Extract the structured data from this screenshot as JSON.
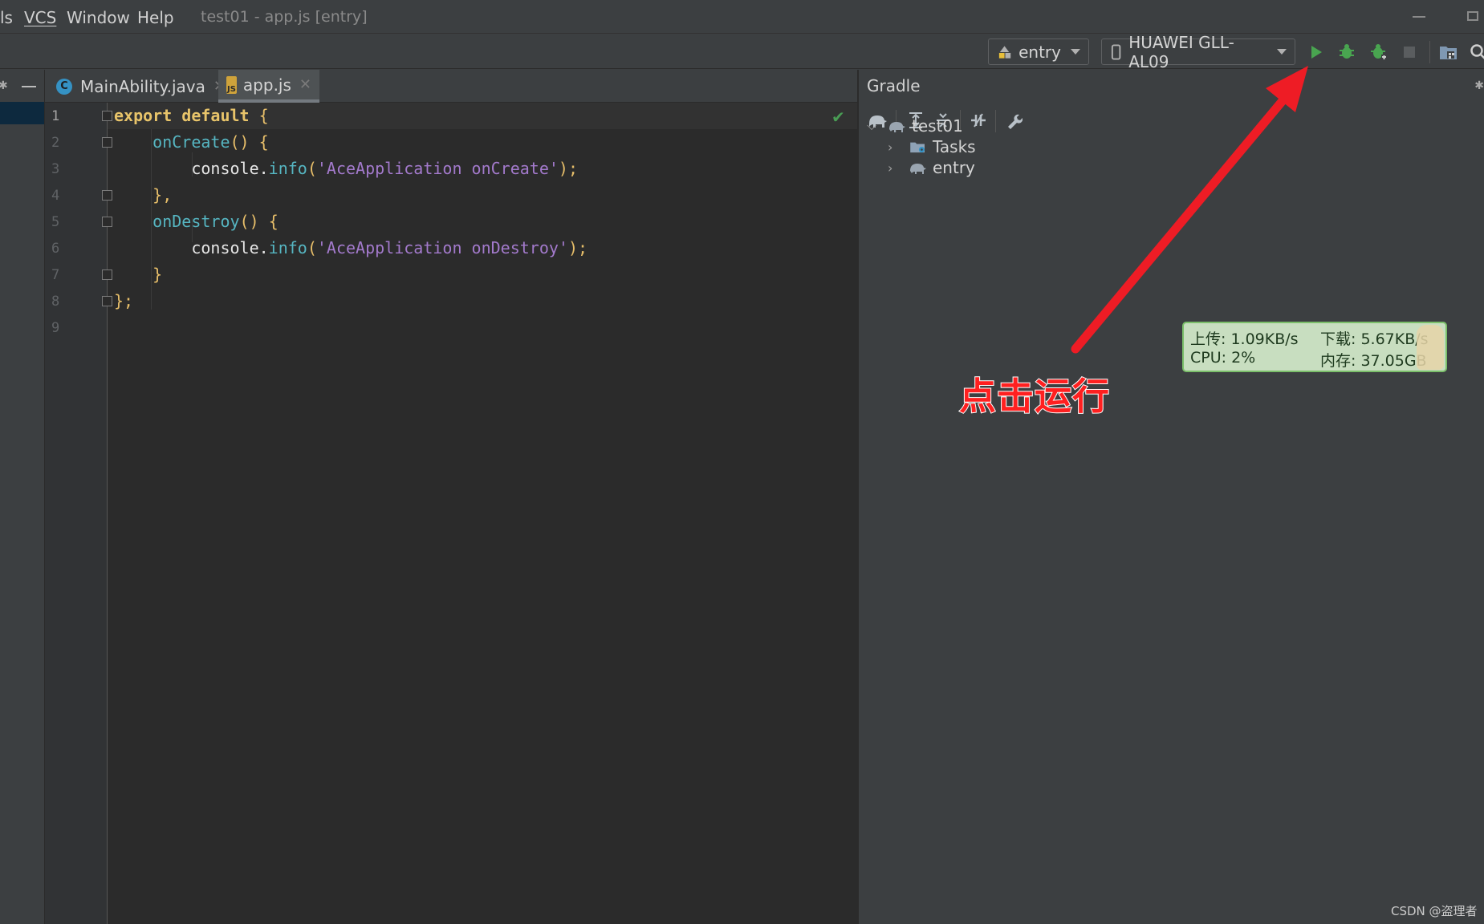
{
  "menubar": {
    "items": [
      "ls",
      "VCS",
      "Window",
      "Help"
    ],
    "title": "test01 - app.js [entry]"
  },
  "toolbar": {
    "module_combo": "entry",
    "device_combo": "HUAWEI GLL-AL09",
    "icons": [
      "module-icon",
      "phone-icon",
      "run-icon",
      "debug-icon",
      "attach-debugger-icon",
      "stop-icon",
      "project-structure-icon",
      "search-icon"
    ]
  },
  "editor": {
    "tabs": [
      {
        "label": "MainAbility.java",
        "icon": "c-class-icon",
        "active": false
      },
      {
        "label": "app.js",
        "icon": "js-file-icon",
        "active": true
      }
    ],
    "line_numbers": [
      "1",
      "2",
      "3",
      "4",
      "5",
      "6",
      "7",
      "8",
      "9"
    ],
    "code": {
      "l1_kw1": "export",
      "l1_kw2": "default",
      "l1_brace": "{",
      "l2_fn": "onCreate",
      "l2_paren": "()",
      "l2_brace": "{",
      "l3_obj": "console",
      "l3_dot": ".",
      "l3_method": "info",
      "l3_open": "(",
      "l3_str": "'AceApplication onCreate'",
      "l3_close": ");",
      "l4_close": "},",
      "l5_fn": "onDestroy",
      "l5_paren": "()",
      "l5_brace": "{",
      "l6_obj": "console",
      "l6_dot": ".",
      "l6_method": "info",
      "l6_open": "(",
      "l6_str": "'AceApplication onDestroy'",
      "l6_close": ");",
      "l7_close": "}",
      "l8_close": "};"
    }
  },
  "gradle": {
    "title": "Gradle",
    "tree": [
      {
        "label": "test01",
        "expanded": true
      },
      {
        "label": "Tasks",
        "expanded": false
      },
      {
        "label": "entry",
        "expanded": false
      }
    ]
  },
  "netmon": {
    "upload": "上传: 1.09KB/s",
    "download": "下载: 5.67KB/s",
    "cpu": "CPU: 2%",
    "memory": "内存: 37.05GB"
  },
  "annotation": {
    "text": "点击运行",
    "color": "#ff2020"
  },
  "watermark": "CSDN @盗理者"
}
